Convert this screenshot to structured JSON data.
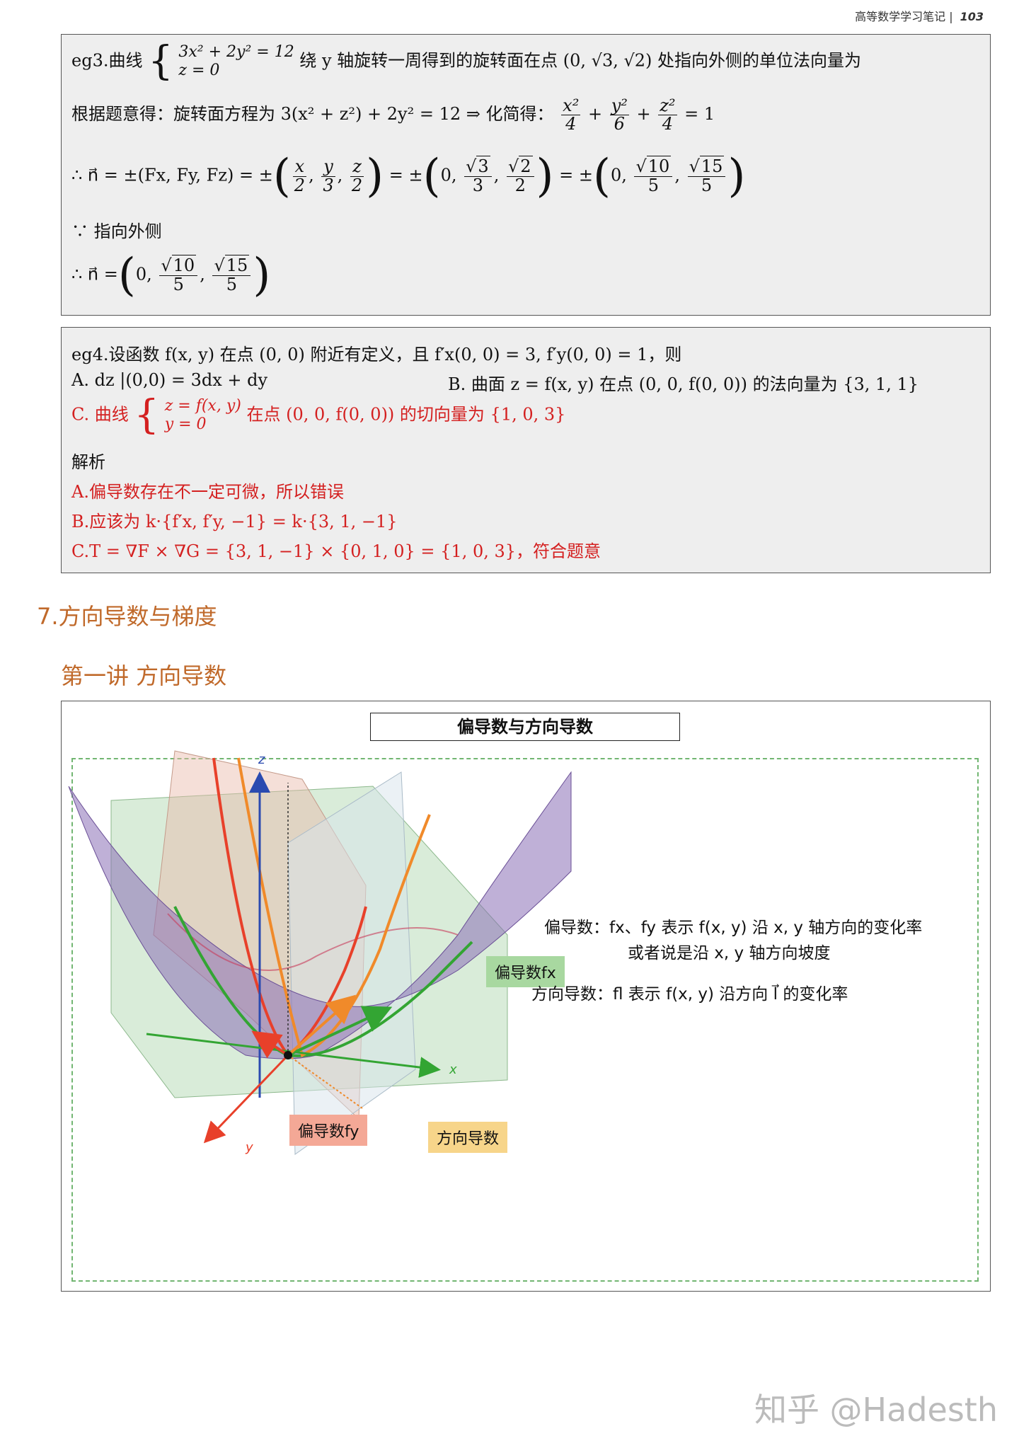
{
  "header": {
    "title": "高等数学学习笔记 |",
    "page": "103"
  },
  "eg3": {
    "prefix": "eg3.曲线",
    "sys_line1": "3x² + 2y² = 12",
    "sys_line2": "z = 0",
    "text": "绕 y 轴旋转一周得到的旋转面在点 (0, √3, √2) 处指向外侧的单位法向量为",
    "line2_a": "根据题意得：旋转面方程为 3(x² + z²) + 2y² = 12    ⇒   化简得：",
    "line2_tail": "= 1",
    "line3_a": "∴ n⃗ = ±(Fx, Fy, Fz) = ±",
    "line4": "∵ 指向外侧",
    "line5_a": "∴ n⃗ ="
  },
  "eg4": {
    "q": "eg4.设函数 f(x, y) 在点 (0, 0) 附近有定义，且 f′x(0, 0) = 3, f′y(0, 0) = 1，则",
    "optA": "A. dz |(0,0) = 3dx + dy",
    "optB": "B. 曲面 z = f(x, y) 在点 (0, 0, f(0, 0)) 的法向量为 {3, 1, 1}",
    "optC_prefix": "C. 曲线",
    "optC_l1": "z = f(x, y)",
    "optC_l2": "y = 0",
    "optC_suffix": "在点 (0, 0, f(0, 0)) 的切向量为 {1, 0, 3}",
    "analysis": "解析",
    "ansA": "A.偏导数存在不一定可微，所以错误",
    "ansB": "B.应该为 k·{f′x, f′y, −1} = k·{3, 1, −1}",
    "ansC": "C.T = ∇F × ∇G = {3, 1, −1} × {0, 1, 0} = {1, 0, 3}，符合题意"
  },
  "section": {
    "title": "7.方向导数与梯度",
    "sub": "第一讲 方向导数"
  },
  "figure": {
    "title": "偏导数与方向导数",
    "desc1": "偏导数：fx、fy 表示 f(x, y) 沿 x, y 轴方向的变化率",
    "desc2": "或者说是沿 x, y 轴方向坡度",
    "desc3": "方向导数：fl 表示 f(x, y) 沿方向 l⃗ 的变化率",
    "tag_fx": "偏导数fx",
    "tag_fy": "偏导数fy",
    "tag_dir": "方向导数",
    "axis_x": "x",
    "axis_y": "y",
    "axis_z": "z"
  },
  "watermark": "知乎 @Hadesth",
  "colors": {
    "section": "#c0692a",
    "red": "#d42020",
    "green_dash": "#72b672"
  }
}
